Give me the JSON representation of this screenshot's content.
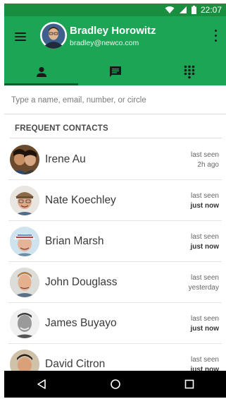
{
  "status": {
    "time": "22:07"
  },
  "header": {
    "name": "Bradley Horowitz",
    "email": "bradley@newco.com"
  },
  "tabs": [
    {
      "id": "people",
      "icon": "person-icon",
      "active": true
    },
    {
      "id": "messages",
      "icon": "message-icon",
      "active": false
    },
    {
      "id": "dialpad",
      "icon": "dialpad-icon",
      "active": false
    }
  ],
  "search": {
    "placeholder": "Type a name, email, number, or circle"
  },
  "section": {
    "title": "FREQUENT CONTACTS"
  },
  "contacts": [
    {
      "name": "Irene Au",
      "seen_label": "last seen",
      "seen_when": "2h ago",
      "bold": false
    },
    {
      "name": "Nate Koechley",
      "seen_label": "last seen",
      "seen_when": "just now",
      "bold": true
    },
    {
      "name": "Brian Marsh",
      "seen_label": "last seen",
      "seen_when": "just now",
      "bold": true
    },
    {
      "name": "John Douglass",
      "seen_label": "last seen",
      "seen_when": "yesterday",
      "bold": false
    },
    {
      "name": "James Buyayo",
      "seen_label": "last seen",
      "seen_when": "just now",
      "bold": true
    },
    {
      "name": "David Citron",
      "seen_label": "last seen",
      "seen_when": "just now",
      "bold": true
    }
  ],
  "colors": {
    "primary": "#1da556",
    "statusbar": "#1a8e3f",
    "tab_indicator": "#0f5e2a"
  }
}
